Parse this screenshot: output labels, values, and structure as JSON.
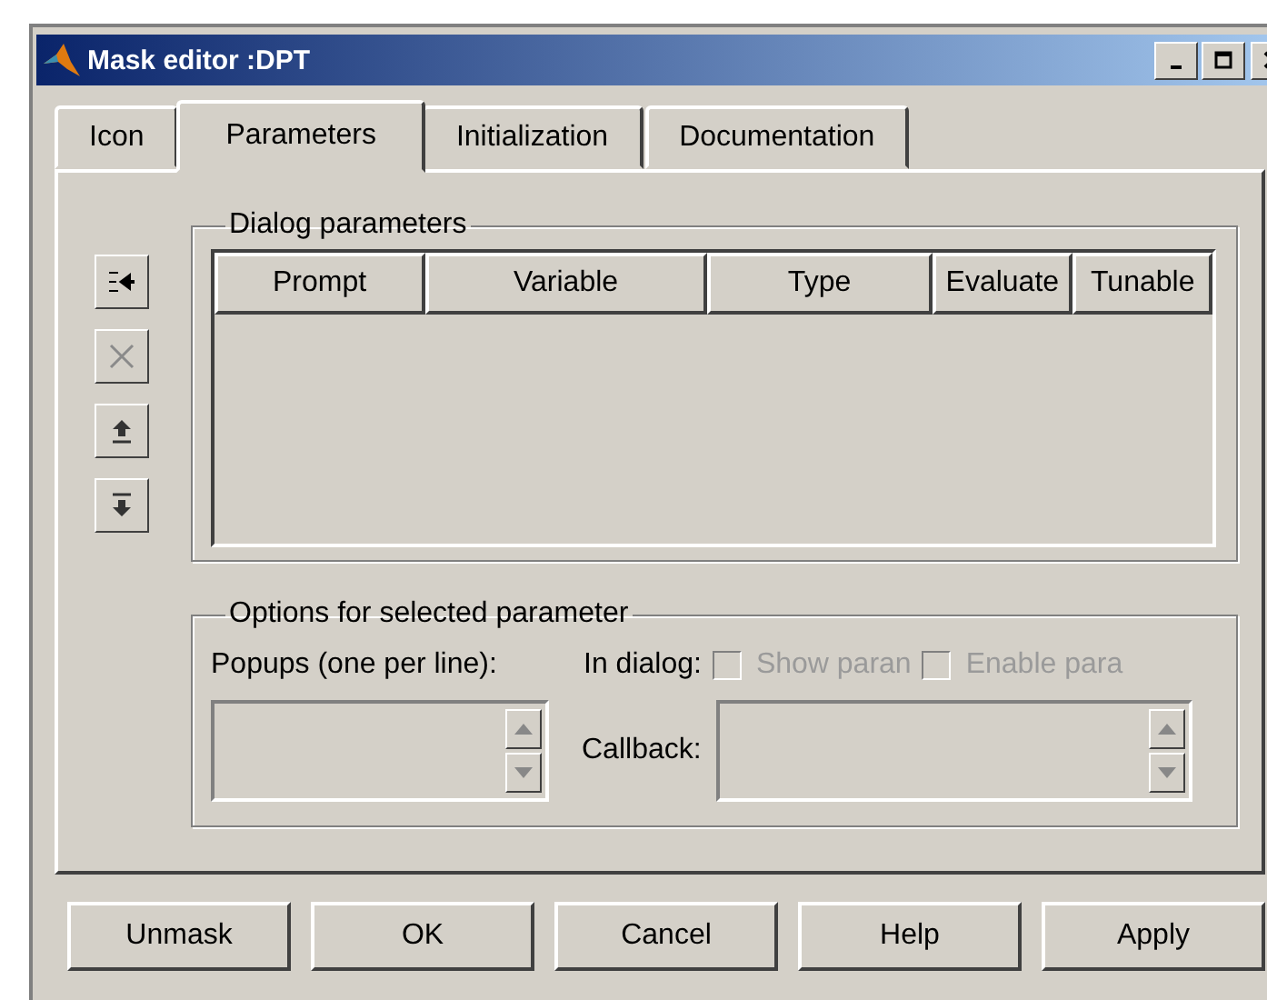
{
  "window": {
    "title": "Mask editor :DPT"
  },
  "tabs": [
    {
      "label": "Icon",
      "selected": false
    },
    {
      "label": "Parameters",
      "selected": true
    },
    {
      "label": "Initialization",
      "selected": false
    },
    {
      "label": "Documentation",
      "selected": false
    }
  ],
  "side_tools": [
    {
      "kind": "add",
      "disabled": false
    },
    {
      "kind": "delete",
      "disabled": true
    },
    {
      "kind": "up",
      "disabled": false
    },
    {
      "kind": "down",
      "disabled": false
    }
  ],
  "dialog_parameters": {
    "title": "Dialog parameters",
    "columns": [
      "Prompt",
      "Variable",
      "Type",
      "Evaluate",
      "Tunable"
    ]
  },
  "options": {
    "title": "Options for selected parameter",
    "popups_label": "Popups (one per line):",
    "in_dialog_label": "In dialog:",
    "checkboxes": [
      {
        "label": "Show paran",
        "checked": false,
        "disabled": true
      },
      {
        "label": "Enable para",
        "checked": false,
        "disabled": true
      }
    ],
    "callback_label": "Callback:"
  },
  "buttons": [
    "Unmask",
    "OK",
    "Cancel",
    "Help",
    "Apply"
  ]
}
